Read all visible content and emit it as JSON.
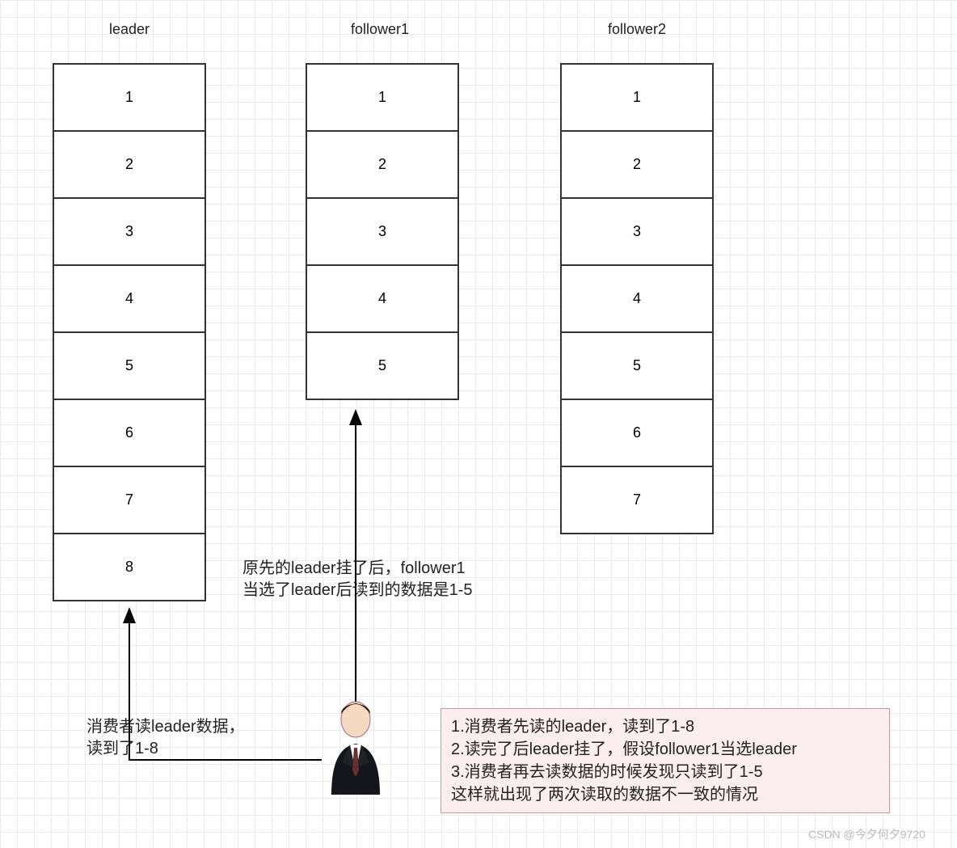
{
  "columns": {
    "leader": {
      "title": "leader",
      "items": [
        "1",
        "2",
        "3",
        "4",
        "5",
        "6",
        "7",
        "8"
      ]
    },
    "follower1": {
      "title": "follower1",
      "items": [
        "1",
        "2",
        "3",
        "4",
        "5"
      ]
    },
    "follower2": {
      "title": "follower2",
      "items": [
        "1",
        "2",
        "3",
        "4",
        "5",
        "6",
        "7"
      ]
    }
  },
  "notes": {
    "leader_read": "消费者读leader数据，\n读到了1-8",
    "follower1_read": "原先的leader挂了后，follower1\n当选了leader后读到的数据是1-5"
  },
  "summary": "1.消费者先读的leader，读到了1-8\n2.读完了后leader挂了，假设follower1当选leader\n3.消费者再去读数据的时候发现只读到了1-5\n这样就出现了两次读取的数据不一致的情况",
  "watermark": "CSDN @今夕何夕9720"
}
